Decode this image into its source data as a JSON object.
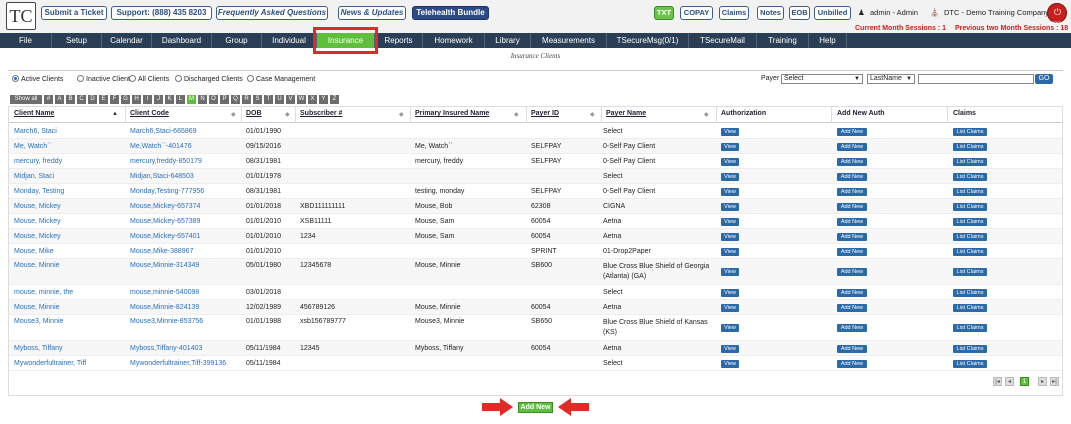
{
  "header": {
    "logo_text": "TC",
    "buttons": [
      "Submit a Ticket",
      "Support: (888) 435 8203",
      "Frequently Asked Questions",
      "News & Updates",
      "Telehealth Bundle"
    ],
    "quick_links": [
      "TXT",
      "COPAY",
      "Claims",
      "Notes",
      "EOB",
      "Unbilled"
    ],
    "user_label": "admin - Admin",
    "company_label": "DTC - Demo Training Company",
    "logout_label": "LOGOUT",
    "sessions_current": "Current Month Sessions : 1",
    "sessions_prev": "Previous two Month Sessions : 18"
  },
  "nav": {
    "items": [
      "File",
      "Setup",
      "Calendar",
      "Dashboard",
      "Group",
      "Individual",
      "Insurance",
      "Reports",
      "Homework",
      "Library",
      "Measurements",
      "TSecureMsg(0/1)",
      "TSecureMail",
      "Training",
      "Help"
    ],
    "active": "Insurance"
  },
  "page_title": "Insurance Clients",
  "filters": {
    "radios": [
      "Active Clients",
      "Inactive Clients",
      "All Clients",
      "Discharged Clients",
      "Case Management"
    ],
    "selected": "Active Clients",
    "payer_label": "Payer",
    "payer_value": "Select",
    "sort_value": "LastName",
    "search_value": "",
    "go_label": "GO"
  },
  "alphabet": [
    "Show all",
    "#",
    "A",
    "B",
    "C",
    "D",
    "E",
    "F",
    "G",
    "H",
    "I",
    "J",
    "K",
    "L",
    "M",
    "N",
    "O",
    "P",
    "Q",
    "R",
    "S",
    "T",
    "U",
    "V",
    "W",
    "X",
    "Y",
    "Z"
  ],
  "alphabet_active": "M",
  "table": {
    "headers": [
      "Client Name",
      "Client Code",
      "DOB",
      "Subscriber #",
      "Primary Insured Name",
      "Payer ID",
      "Payer Name",
      "Authorization",
      "Add New Auth",
      "Claims"
    ],
    "rows": [
      [
        "March6, Staci",
        "March6,Staci-665869",
        "01/01/1990",
        "",
        "",
        "",
        "Select"
      ],
      [
        "Me, Watch``",
        "Me,Watch``-401476",
        "09/15/2016",
        "",
        "Me, Watch``",
        "SELFPAY",
        "0-Self Pay Client"
      ],
      [
        "mercury, freddy",
        "mercury,freddy-850179",
        "08/31/1981",
        "",
        "mercury, freddy",
        "SELFPAY",
        "0-Self Pay Client"
      ],
      [
        "Midjan, Staci",
        "Midjan,Staci-648503",
        "01/01/1978",
        "",
        "",
        "",
        "Select"
      ],
      [
        "Monday, Testing",
        "Monday,Testing-777956",
        "08/31/1981",
        "",
        "testing, monday",
        "SELFPAY",
        "0-Self Pay Client"
      ],
      [
        "Mouse, Mickey",
        "Mouse,Mickey-657374",
        "01/01/2018",
        "XBD111111111",
        "Mouse, Bob",
        "62308",
        "CIGNA"
      ],
      [
        "Mouse, Mickey",
        "Mouse,Mickey-657389",
        "01/01/2010",
        "XSB11111",
        "Mouse, Sam",
        "60054",
        "Aetna"
      ],
      [
        "Mouse, Mickey",
        "Mouse,Mickey-657401",
        "01/01/2010",
        "1234",
        "Mouse, Sam",
        "60054",
        "Aetna"
      ],
      [
        "Mouse, Mike",
        "Mouse,Mike-388967",
        "01/01/2010",
        "",
        "",
        "SPRINT",
        "01-Drop2Paper"
      ],
      [
        "Mouse, Minnie",
        "Mouse,Minnie-314349",
        "05/01/1980",
        "12345678",
        "Mouse, Minnie",
        "SB600",
        "Blue Cross Blue Shield of Georgia (Atlanta) (GA)"
      ],
      [
        "mouse, minnie, the",
        "mouse,minnie-540098",
        "03/01/2018",
        "",
        "",
        "",
        "Select"
      ],
      [
        "Mouse, Minnie",
        "Mouse,Minnie-824139",
        "12/02/1989",
        "456789126",
        "Mouse, Minnie",
        "60054",
        "Aetna"
      ],
      [
        "Mouse3, Minnie",
        "Mouse3,Minnie-853756",
        "01/01/1988",
        "xsb156789777",
        "Mouse3, Minnie",
        "SB650",
        "Blue Cross Blue Shield of Kansas (KS)"
      ],
      [
        "Myboss, Tiffany",
        "Myboss,Tiffany-401403",
        "05/11/1984",
        "12345",
        "Myboss, Tiffany",
        "60054",
        "Aetna"
      ],
      [
        "Mywonderfultrainer, Tiff",
        "Mywonderfultrainer,Tiff-399136",
        "05/11/1984",
        "",
        "",
        "",
        "Select"
      ]
    ],
    "view_label": "View",
    "add_new_label": "Add New",
    "list_claims_label": "List Claims"
  },
  "pagination": [
    "|◂",
    "◂",
    "1",
    "▸",
    "▸|"
  ],
  "pagination_current": "1",
  "add_new_button": "Add New",
  "colors": {
    "nav_bg": "#2a3e55",
    "active_green": "#5fbf3a",
    "link_blue": "#2a6fb8",
    "button_blue": "#2a6aa8",
    "highlight_red": "#e12a26"
  }
}
